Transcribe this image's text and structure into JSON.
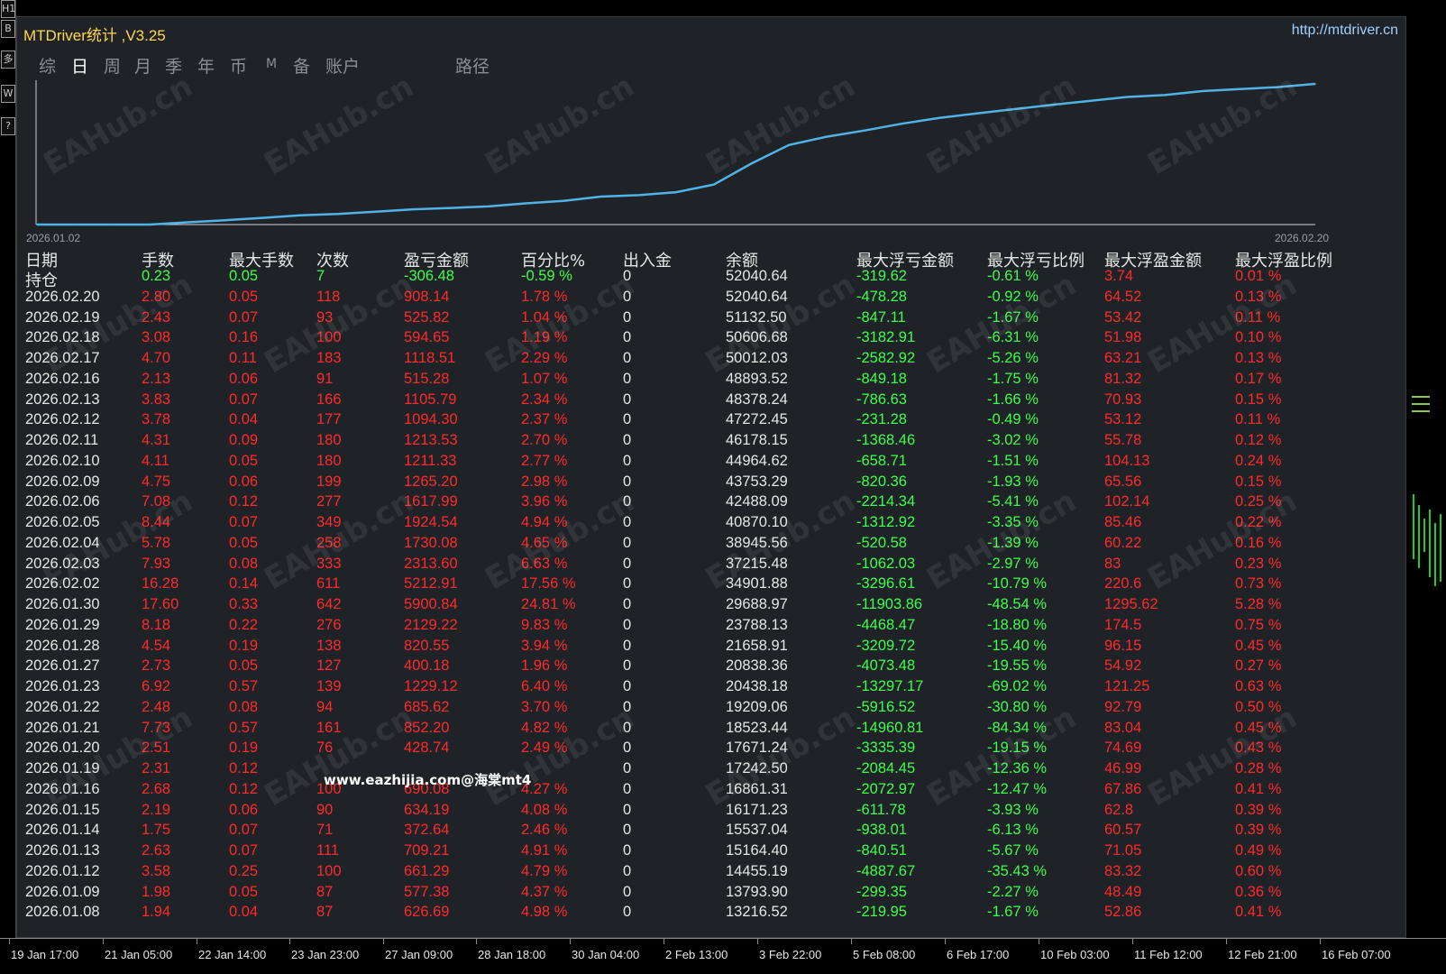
{
  "window": {
    "title": "MTDriver统计 ,V3.25",
    "url": "http://mtdriver.cn"
  },
  "tabs": [
    {
      "label": "综",
      "active": false
    },
    {
      "label": "日",
      "active": true
    },
    {
      "label": "周",
      "active": false
    },
    {
      "label": "月",
      "active": false
    },
    {
      "label": "季",
      "active": false
    },
    {
      "label": "年",
      "active": false
    },
    {
      "label": "币",
      "active": false
    },
    {
      "label": "M",
      "active": false
    },
    {
      "label": "备",
      "active": false
    },
    {
      "label": "账户",
      "active": false
    },
    {
      "label": "路径",
      "active": false
    }
  ],
  "left_toolbar": [
    "H1",
    "B",
    "多",
    "W",
    "?"
  ],
  "chart": {
    "start_date": "2026.01.02",
    "end_date": "2026.02.20",
    "line_color": "#4fb3e6"
  },
  "chart_data": {
    "type": "line",
    "x": [
      "2026.01.02",
      "2026.01.05",
      "2026.01.06",
      "2026.01.07",
      "2026.01.08",
      "2026.01.09",
      "2026.01.12",
      "2026.01.13",
      "2026.01.14",
      "2026.01.15",
      "2026.01.16",
      "2026.01.19",
      "2026.01.20",
      "2026.01.21",
      "2026.01.22",
      "2026.01.23",
      "2026.01.27",
      "2026.01.28",
      "2026.01.29",
      "2026.01.30",
      "2026.02.02",
      "2026.02.03",
      "2026.02.04",
      "2026.02.05",
      "2026.02.06",
      "2026.02.09",
      "2026.02.10",
      "2026.02.11",
      "2026.02.12",
      "2026.02.13",
      "2026.02.16",
      "2026.02.17",
      "2026.02.18",
      "2026.02.19",
      "2026.02.20"
    ],
    "values": [
      12590,
      12590,
      12590,
      12590,
      13216.52,
      13793.9,
      14455.19,
      15164.4,
      15537.04,
      16171.23,
      16861.31,
      17242.5,
      17671.24,
      18523.44,
      19209.06,
      20438.18,
      20838.36,
      21658.91,
      23788.13,
      29688.97,
      34901.88,
      37215.48,
      38945.56,
      40870.1,
      42488.09,
      43753.29,
      44964.62,
      46178.15,
      47272.45,
      48378.24,
      48893.52,
      50012.03,
      50606.68,
      51132.5,
      52040.64
    ],
    "title": "",
    "xlabel": "",
    "ylabel": "",
    "grid": false
  },
  "table": {
    "headers": [
      "日期",
      "手数",
      "最大手数",
      "次数",
      "盈亏金额",
      "百分比%",
      "出入金",
      "余额",
      "最大浮亏金额",
      "最大浮亏比例",
      "最大浮盈金额",
      "最大浮盈比例"
    ],
    "position_row": [
      "持仓",
      "0.23",
      "0.05",
      "7",
      "-306.48",
      "-0.59 %",
      "0",
      "52040.64",
      "-319.62",
      "-0.61 %",
      "3.74",
      "0.01 %"
    ],
    "rows": [
      [
        "2026.02.20",
        "2.80",
        "0.05",
        "118",
        "908.14",
        "1.78 %",
        "0",
        "52040.64",
        "-478.28",
        "-0.92 %",
        "64.52",
        "0.13 %"
      ],
      [
        "2026.02.19",
        "2.43",
        "0.07",
        "93",
        "525.82",
        "1.04 %",
        "0",
        "51132.50",
        "-847.11",
        "-1.67 %",
        "53.42",
        "0.11 %"
      ],
      [
        "2026.02.18",
        "3.08",
        "0.16",
        "100",
        "594.65",
        "1.19 %",
        "0",
        "50606.68",
        "-3182.91",
        "-6.31 %",
        "51.98",
        "0.10 %"
      ],
      [
        "2026.02.17",
        "4.70",
        "0.11",
        "183",
        "1118.51",
        "2.29 %",
        "0",
        "50012.03",
        "-2582.92",
        "-5.26 %",
        "63.21",
        "0.13 %"
      ],
      [
        "2026.02.16",
        "2.13",
        "0.06",
        "91",
        "515.28",
        "1.07 %",
        "0",
        "48893.52",
        "-849.18",
        "-1.75 %",
        "81.32",
        "0.17 %"
      ],
      [
        "2026.02.13",
        "3.83",
        "0.07",
        "166",
        "1105.79",
        "2.34 %",
        "0",
        "48378.24",
        "-786.63",
        "-1.66 %",
        "70.93",
        "0.15 %"
      ],
      [
        "2026.02.12",
        "3.78",
        "0.04",
        "177",
        "1094.30",
        "2.37 %",
        "0",
        "47272.45",
        "-231.28",
        "-0.49 %",
        "53.12",
        "0.11 %"
      ],
      [
        "2026.02.11",
        "4.31",
        "0.09",
        "180",
        "1213.53",
        "2.70 %",
        "0",
        "46178.15",
        "-1368.46",
        "-3.02 %",
        "55.78",
        "0.12 %"
      ],
      [
        "2026.02.10",
        "4.11",
        "0.05",
        "180",
        "1211.33",
        "2.77 %",
        "0",
        "44964.62",
        "-658.71",
        "-1.51 %",
        "104.13",
        "0.24 %"
      ],
      [
        "2026.02.09",
        "4.75",
        "0.06",
        "199",
        "1265.20",
        "2.98 %",
        "0",
        "43753.29",
        "-820.36",
        "-1.93 %",
        "65.56",
        "0.15 %"
      ],
      [
        "2026.02.06",
        "7.08",
        "0.12",
        "277",
        "1617.99",
        "3.96 %",
        "0",
        "42488.09",
        "-2214.34",
        "-5.41 %",
        "102.14",
        "0.25 %"
      ],
      [
        "2026.02.05",
        "8.44",
        "0.07",
        "349",
        "1924.54",
        "4.94 %",
        "0",
        "40870.10",
        "-1312.92",
        "-3.35 %",
        "85.46",
        "0.22 %"
      ],
      [
        "2026.02.04",
        "5.78",
        "0.05",
        "258",
        "1730.08",
        "4.65 %",
        "0",
        "38945.56",
        "-520.58",
        "-1.39 %",
        "60.22",
        "0.16 %"
      ],
      [
        "2026.02.03",
        "7.93",
        "0.08",
        "333",
        "2313.60",
        "6.63 %",
        "0",
        "37215.48",
        "-1062.03",
        "-2.97 %",
        "83",
        "0.23 %"
      ],
      [
        "2026.02.02",
        "16.28",
        "0.14",
        "611",
        "5212.91",
        "17.56 %",
        "0",
        "34901.88",
        "-3296.61",
        "-10.79 %",
        "220.6",
        "0.73 %"
      ],
      [
        "2026.01.30",
        "17.60",
        "0.33",
        "642",
        "5900.84",
        "24.81 %",
        "0",
        "29688.97",
        "-11903.86",
        "-48.54 %",
        "1295.62",
        "5.28 %"
      ],
      [
        "2026.01.29",
        "8.18",
        "0.22",
        "276",
        "2129.22",
        "9.83 %",
        "0",
        "23788.13",
        "-4468.47",
        "-18.80 %",
        "174.5",
        "0.75 %"
      ],
      [
        "2026.01.28",
        "4.54",
        "0.19",
        "138",
        "820.55",
        "3.94 %",
        "0",
        "21658.91",
        "-3209.72",
        "-15.40 %",
        "96.15",
        "0.45 %"
      ],
      [
        "2026.01.27",
        "2.73",
        "0.05",
        "127",
        "400.18",
        "1.96 %",
        "0",
        "20838.36",
        "-4073.48",
        "-19.55 %",
        "54.92",
        "0.27 %"
      ],
      [
        "2026.01.23",
        "6.92",
        "0.57",
        "139",
        "1229.12",
        "6.40 %",
        "0",
        "20438.18",
        "-13297.17",
        "-69.02 %",
        "121.25",
        "0.63 %"
      ],
      [
        "2026.01.22",
        "2.48",
        "0.08",
        "94",
        "685.62",
        "3.70 %",
        "0",
        "19209.06",
        "-5916.52",
        "-30.80 %",
        "92.79",
        "0.50 %"
      ],
      [
        "2026.01.21",
        "7.73",
        "0.57",
        "161",
        "852.20",
        "4.82 %",
        "0",
        "18523.44",
        "-14960.81",
        "-84.34 %",
        "83.04",
        "0.45 %"
      ],
      [
        "2026.01.20",
        "2.51",
        "0.19",
        "76",
        "428.74",
        "2.49 %",
        "0",
        "17671.24",
        "-3335.39",
        "-19.15 %",
        "74.69",
        "0.43 %"
      ],
      [
        "2026.01.19",
        "2.31",
        "0.12",
        "",
        "",
        "",
        "0",
        "17242.50",
        "-2084.45",
        "-12.36 %",
        "46.99",
        "0.28 %"
      ],
      [
        "2026.01.16",
        "2.68",
        "0.12",
        "100",
        "690.08",
        "4.27 %",
        "0",
        "16861.31",
        "-2072.97",
        "-12.47 %",
        "67.86",
        "0.41 %"
      ],
      [
        "2026.01.15",
        "2.19",
        "0.06",
        "90",
        "634.19",
        "4.08 %",
        "0",
        "16171.23",
        "-611.78",
        "-3.93 %",
        "62.8",
        "0.39 %"
      ],
      [
        "2026.01.14",
        "1.75",
        "0.07",
        "71",
        "372.64",
        "2.46 %",
        "0",
        "15537.04",
        "-938.01",
        "-6.13 %",
        "60.57",
        "0.39 %"
      ],
      [
        "2026.01.13",
        "2.63",
        "0.07",
        "111",
        "709.21",
        "4.91 %",
        "0",
        "15164.40",
        "-840.51",
        "-5.67 %",
        "71.05",
        "0.49 %"
      ],
      [
        "2026.01.12",
        "3.58",
        "0.25",
        "100",
        "661.29",
        "4.79 %",
        "0",
        "14455.19",
        "-4887.67",
        "-35.43 %",
        "83.32",
        "0.60 %"
      ],
      [
        "2026.01.09",
        "1.98",
        "0.05",
        "87",
        "577.38",
        "4.37 %",
        "0",
        "13793.90",
        "-299.35",
        "-2.27 %",
        "48.49",
        "0.36 %"
      ],
      [
        "2026.01.08",
        "1.94",
        "0.04",
        "87",
        "626.69",
        "4.98 %",
        "0",
        "13216.52",
        "-219.95",
        "-1.67 %",
        "52.86",
        "0.41 %"
      ]
    ]
  },
  "watermark": {
    "text": "www.eazhijia.com@海棠mt4",
    "repeat": "EAHub.cn"
  },
  "time_axis": [
    "19 Jan 17:00",
    "21 Jan 05:00",
    "22 Jan 14:00",
    "23 Jan 23:00",
    "27 Jan 09:00",
    "28 Jan 18:00",
    "30 Jan 04:00",
    "2 Feb 13:00",
    "3 Feb 22:00",
    "5 Feb 08:00",
    "6 Feb 17:00",
    "10 Feb 03:00",
    "11 Feb 12:00",
    "12 Feb 21:00",
    "16 Feb 07:00"
  ],
  "colors": {
    "panel_bg": "#1f2227",
    "profit_red": "#ff2a2a",
    "loss_green": "#3cff4a",
    "title_yellow": "#ffd84a"
  }
}
